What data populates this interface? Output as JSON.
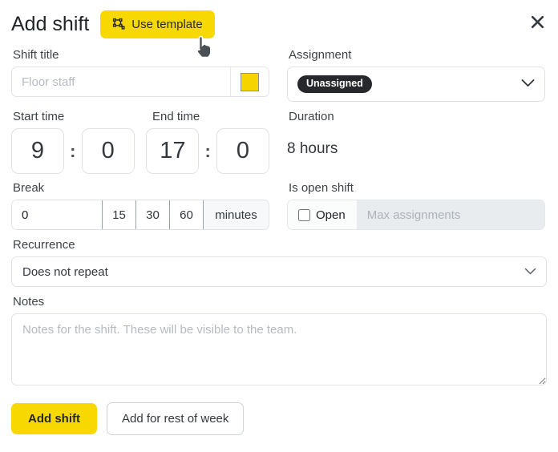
{
  "dialog": {
    "title": "Add shift",
    "use_template_label": "Use template",
    "use_template_icon": "template-frame-icon",
    "close_icon": "close-icon",
    "accent_color": "#f7d800",
    "pill_color": "#26282b"
  },
  "shift_title": {
    "label": "Shift title",
    "value": "",
    "placeholder": "Floor staff",
    "color_swatch": "#f5d400"
  },
  "assignment": {
    "label": "Assignment",
    "selected": "Unassigned",
    "chevron_icon": "chevron-down-icon"
  },
  "start_time": {
    "label": "Start time",
    "hours": "9",
    "minutes": "0",
    "separator": ":"
  },
  "end_time": {
    "label": "End time",
    "hours": "17",
    "minutes": "0",
    "separator": ":"
  },
  "duration": {
    "label": "Duration",
    "value": "8 hours"
  },
  "break": {
    "label": "Break",
    "value": "0",
    "quick_options": [
      "15",
      "30",
      "60"
    ],
    "unit": "minutes"
  },
  "open_shift": {
    "label": "Is open shift",
    "checkbox_label": "Open",
    "checked": false,
    "max_assignments_value": "",
    "max_assignments_placeholder": "Max assignments"
  },
  "recurrence": {
    "label": "Recurrence",
    "selected": "Does not repeat",
    "chevron_icon": "chevron-down-icon"
  },
  "notes": {
    "label": "Notes",
    "value": "",
    "placeholder": "Notes for the shift. These will be visible to the team."
  },
  "footer": {
    "primary_label": "Add shift",
    "secondary_label": "Add for rest of week"
  },
  "cursor": {
    "icon": "pointer-hand-cursor"
  }
}
